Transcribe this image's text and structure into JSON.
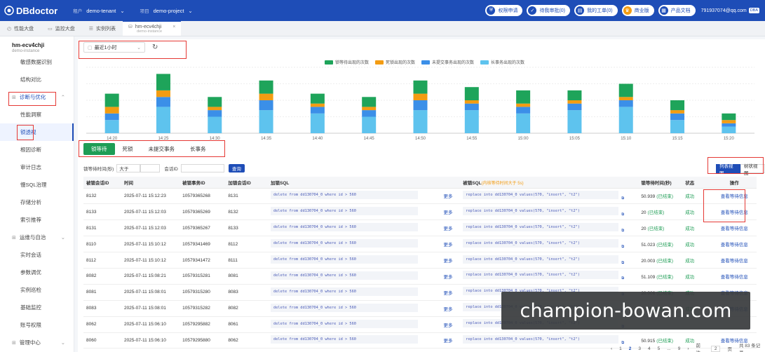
{
  "app": {
    "logo": "DBdoctor",
    "tenant_key": "租户",
    "tenant": "demo-tenant",
    "project_key": "项目",
    "project": "demo-project",
    "pills": [
      {
        "icon": "shield-icon",
        "label": "权限申请"
      },
      {
        "icon": "check-icon",
        "label": "待我审批(0)"
      },
      {
        "icon": "doc-icon",
        "label": "我的工单(0)"
      },
      {
        "icon": "crown-icon",
        "label": "商业版",
        "orange": true
      },
      {
        "icon": "book-icon",
        "label": "产品文档"
      }
    ],
    "user": "791937074@qq.com",
    "user_tag": "DBA"
  },
  "tabs": [
    {
      "label": "性能大盘"
    },
    {
      "label": "监控大盘"
    },
    {
      "label": "实例列表"
    }
  ],
  "active_tab": {
    "label": "hm-ecv4chji",
    "sub": "demo-instance"
  },
  "instance": {
    "name": "hm-ecv4chji",
    "sub": "demo-instance"
  },
  "sidebar": {
    "items": [
      {
        "label": "敏感数据识别",
        "type": "item"
      },
      {
        "label": "结构对比",
        "type": "item"
      },
      {
        "label": "诊断与优化",
        "type": "group",
        "open": true
      },
      {
        "label": "性能洞察",
        "type": "item"
      },
      {
        "label": "锁透视",
        "type": "item",
        "selected": true
      },
      {
        "label": "根因诊断",
        "type": "item"
      },
      {
        "label": "审计日志",
        "type": "item"
      },
      {
        "label": "慢SQL治理",
        "type": "item"
      },
      {
        "label": "存储分析",
        "type": "item"
      },
      {
        "label": "索引推荐",
        "type": "item"
      },
      {
        "label": "运维与自治",
        "type": "group"
      },
      {
        "label": "实时会话",
        "type": "item"
      },
      {
        "label": "参数调优",
        "type": "item"
      },
      {
        "label": "实例巡检",
        "type": "item"
      },
      {
        "label": "基础监控",
        "type": "item"
      },
      {
        "label": "账号权限",
        "type": "item"
      },
      {
        "label": "管理中心",
        "type": "group"
      }
    ]
  },
  "time_select": "最近1小时",
  "colors": {
    "brand": "#1e4db7",
    "green": "#1e9d55",
    "orange": "#f39c12",
    "blue": "#3b8fe8",
    "cyan": "#5ec3ee"
  },
  "chart_data": {
    "type": "bar",
    "stacked": true,
    "categories": [
      "14:20",
      "14:25",
      "14:30",
      "14:35",
      "14:40",
      "14:45",
      "14:50",
      "14:55",
      "15:00",
      "15:05",
      "15:10",
      "15:15",
      "15:20"
    ],
    "series": [
      {
        "name": "锁等待出现的次数",
        "color": "#1ea45a",
        "values": [
          4,
          5,
          3,
          4,
          3,
          3,
          4,
          4,
          4,
          3,
          4,
          3,
          2
        ]
      },
      {
        "name": "死锁出现的次数",
        "color": "#f39c12",
        "values": [
          2,
          2,
          1,
          2,
          1,
          1,
          2,
          1,
          1,
          1,
          1,
          1,
          1
        ]
      },
      {
        "name": "未提交事务出现的次数",
        "color": "#3b8fe8",
        "values": [
          2,
          3,
          2,
          3,
          2,
          2,
          3,
          2,
          2,
          2,
          2,
          2,
          1
        ]
      },
      {
        "name": "长事务出现的次数",
        "color": "#5ec3ee",
        "values": [
          4,
          8,
          5,
          7,
          6,
          5,
          7,
          7,
          6,
          7,
          8,
          4,
          2
        ]
      }
    ],
    "xlabel": "",
    "ylabel": "",
    "grid": true,
    "legend": "top"
  },
  "filter_tabs": [
    {
      "label": "锁等待",
      "active": true
    },
    {
      "label": "死锁"
    },
    {
      "label": "未提交事务"
    },
    {
      "label": "长事务"
    }
  ],
  "filter": {
    "label1": "锁等待时间(秒)",
    "op": "大于",
    "label2": "会话ID",
    "btn": "查询"
  },
  "view_btns": [
    {
      "label": "列表视图",
      "active": true
    },
    {
      "label": "树状视图"
    }
  ],
  "table": {
    "headers": [
      "被锁会话ID",
      "时间",
      "被锁事务ID",
      "加锁会话ID",
      "加锁SQL",
      "",
      "被锁SQL",
      "锁等待时间(秒)",
      "状态",
      "操作"
    ],
    "header_note": "(内核等待时间大于 5s)",
    "rows": [
      [
        "8132",
        "2025-07-11 15:12:23",
        "10579365268",
        "8131",
        "delete from dd130704_0 where id > 560",
        "更多",
        "replace into dd130704_0 values(570, \"insert\", \"t2\")",
        "50.939",
        "(已结束)",
        "成功",
        "查看等待信息"
      ],
      [
        "8133",
        "2025-07-11 15:12:03",
        "10579365269",
        "8132",
        "delete from dd130704_0 where id > 560",
        "更多",
        "replace into dd130704_0 values(570, \"insert\", \"t2\")",
        "20",
        "(已结束)",
        "成功",
        "查看等待信息"
      ],
      [
        "8131",
        "2025-07-11 15:12:03",
        "10579365267",
        "8133",
        "delete from dd130704_0 where id > 560",
        "更多",
        "replace into dd130704_0 values(570, \"insert\", \"t2\")",
        "20",
        "(已结束)",
        "成功",
        "查看等待信息"
      ],
      [
        "8110",
        "2025-07-11 15:10:12",
        "10579341469",
        "8112",
        "delete from dd130704_0 where id > 560",
        "更多",
        "replace into dd130704_0 values(570, \"insert\", \"t2\")",
        "51.023",
        "(已结束)",
        "成功",
        "查看等待信息"
      ],
      [
        "8112",
        "2025-07-11 15:10:12",
        "10579341472",
        "8111",
        "delete from dd130704_0 where id > 560",
        "更多",
        "replace into dd130704_0 values(570, \"insert\", \"t2\")",
        "20.003",
        "(已结束)",
        "成功",
        "查看等待信息"
      ],
      [
        "8082",
        "2025-07-11 15:08:21",
        "10579315281",
        "8081",
        "delete from dd130704_0 where id > 560",
        "更多",
        "replace into dd130704_0 values(570, \"insert\", \"t2\")",
        "51.109",
        "(已结束)",
        "成功",
        "查看等待信息"
      ],
      [
        "8081",
        "2025-07-11 15:08:01",
        "10579315280",
        "8083",
        "delete from dd130704_0 where id > 560",
        "更多",
        "replace into dd130704_0 values(570, \"insert\", \"t2\")",
        "20.006",
        "(已结束)",
        "成功",
        "查看等待信息"
      ],
      [
        "8083",
        "2025-07-11 15:08:01",
        "10579315282",
        "8082",
        "delete from dd130704_0 where id > 560",
        "更多",
        "replace into dd130704_0 values(570, \"insert\", \"t2\")",
        "20",
        "(已结束)",
        "成功",
        "查看等待信息"
      ],
      [
        "8062",
        "2025-07-11 15:06:10",
        "10579295882",
        "8061",
        "delete from dd130704_0 where id > 560",
        "更多",
        "replace into dd130704_0 values(570, \"insert\", \"t2\")",
        "",
        "",
        "",
        ""
      ],
      [
        "8060",
        "2025-07-11 15:06:10",
        "10579295880",
        "8062",
        "delete from dd130704_0 where id > 560",
        "更多",
        "replace into dd130704_0 values(570, \"insert\", \"t2\")",
        "50.915",
        "(已结束)",
        "成功",
        "查看等待信息"
      ]
    ]
  },
  "pager": {
    "prev": "‹",
    "pages": [
      "1",
      "2",
      "3",
      "4",
      "5",
      "...",
      "9"
    ],
    "next": "›",
    "goto": "前往",
    "goto_val": "2",
    "unit": "页",
    "total": "共 83 条记录"
  },
  "watermark": "champion-bowan.com"
}
